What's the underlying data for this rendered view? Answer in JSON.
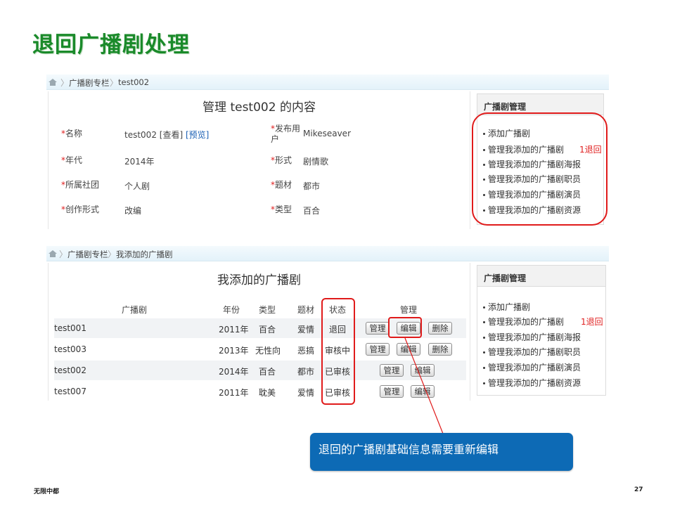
{
  "slide": {
    "title": "退回广播剧处理",
    "footer_left": "无限中都",
    "page_number": "27"
  },
  "top": {
    "breadcrumb": [
      "广播剧专栏",
      "test002"
    ],
    "title": "管理 test002 的内容",
    "fields": [
      {
        "label": "名称",
        "value": "test002",
        "view_label": "[查看]",
        "preview_label": "[预览]"
      },
      {
        "label": "年代",
        "value": "2014年"
      },
      {
        "label": "所属社团",
        "value": "个人剧"
      },
      {
        "label": "创作形式",
        "value": "改编"
      },
      {
        "label": "发布用户",
        "label_line1": "发布用",
        "label_line2": "户",
        "value": "Mikeseaver"
      },
      {
        "label": "形式",
        "value": "剧情歌"
      },
      {
        "label": "题材",
        "value": "都市"
      },
      {
        "label": "类型",
        "value": "百合"
      }
    ],
    "sidebar": {
      "title": "广播剧管理",
      "items": [
        "添加广播剧",
        "管理我添加的广播剧",
        "管理我添加的广播剧海报",
        "管理我添加的广播剧职员",
        "管理我添加的广播剧演员",
        "管理我添加的广播剧资源"
      ],
      "badge": "1退回"
    }
  },
  "bottom": {
    "breadcrumb": [
      "广播剧专栏",
      "我添加的广播剧"
    ],
    "title": "我添加的广播剧",
    "columns": [
      "广播剧",
      "年份",
      "类型",
      "题材",
      "状态",
      "管理"
    ],
    "rows": [
      {
        "name": "test001",
        "year": "2011年",
        "type": "百合",
        "theme": "爱情",
        "status": "退回"
      },
      {
        "name": "test003",
        "year": "2013年",
        "type": "无性向",
        "theme": "恶搞",
        "status": "审核中"
      },
      {
        "name": "test002",
        "year": "2014年",
        "type": "百合",
        "theme": "都市",
        "status": "已审核"
      },
      {
        "name": "test007",
        "year": "2011年",
        "type": "耽美",
        "theme": "爱情",
        "status": "已审核"
      }
    ],
    "buttons": {
      "manage": "管理",
      "edit": "编辑",
      "delete": "删除"
    },
    "sidebar": {
      "title": "广播剧管理",
      "items": [
        "添加广播剧",
        "管理我添加的广播剧",
        "管理我添加的广播剧海报",
        "管理我添加的广播剧职员",
        "管理我添加的广播剧演员",
        "管理我添加的广播剧资源"
      ],
      "badge": "1退回"
    }
  },
  "callout": {
    "text": "退回的广播剧基础信息需要重新编辑"
  },
  "colors": {
    "title_green": "#1a8a2a",
    "highlight_red": "#e01b1b",
    "callout_blue": "#0d6ab5",
    "required_red": "#e02020",
    "link_blue": "#1a5fb4"
  },
  "icons": [
    "home-icon"
  ]
}
